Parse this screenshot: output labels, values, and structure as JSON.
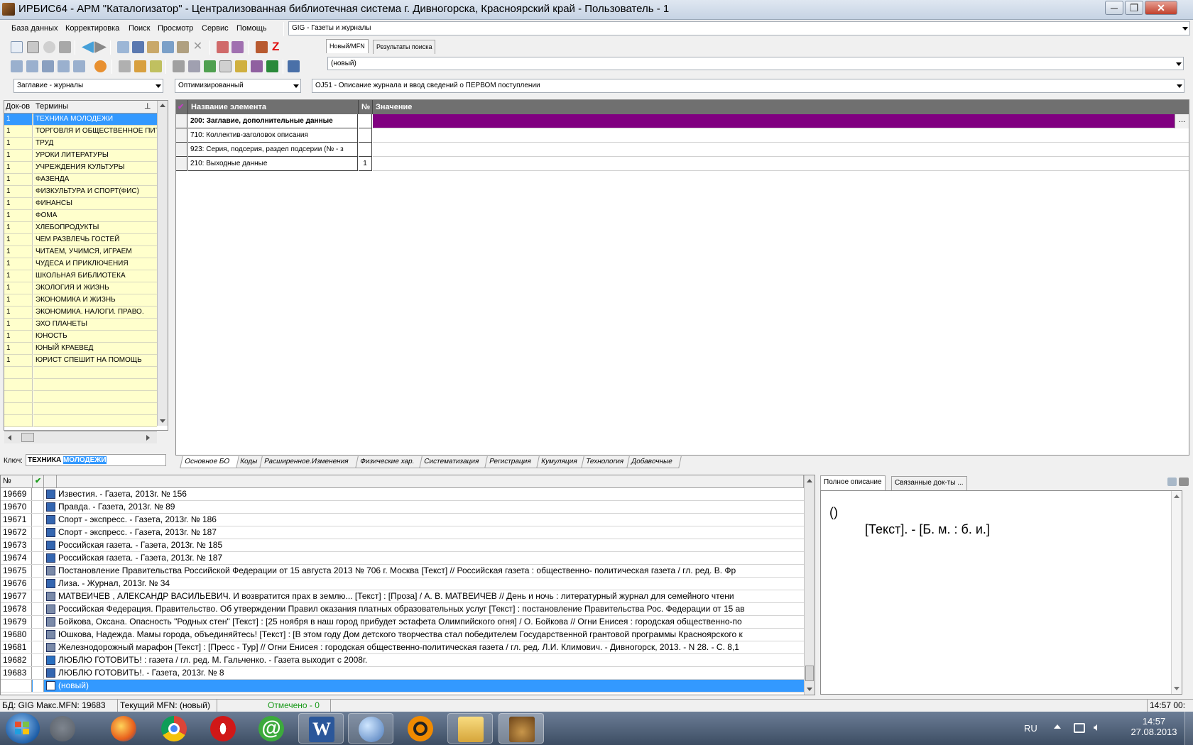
{
  "window": {
    "title": "ИРБИС64 - АРМ \"Каталогизатор\" - Централизованная библиотечная система г. Дивногорска, Красноярский край - Пользователь - 1",
    "minimize": "─",
    "maximize": "❐",
    "close": "✕"
  },
  "menu": {
    "items": [
      "База данных",
      "Корректировка",
      "Поиск",
      "Просмотр",
      "Сервис",
      "Помощь"
    ]
  },
  "database_combo": {
    "value": "GIG - Газеты и журналы"
  },
  "record_tabs": {
    "new_mfn": "Новый/MFN",
    "search_results": "Результаты поиска"
  },
  "record_combo": {
    "value": "(новый)"
  },
  "dictionary_combo": {
    "value": "Заглавие - журналы"
  },
  "mode_combo": {
    "value": "Оптимизированный"
  },
  "worksheet_combo": {
    "value": "OJ51 - Описание журнала и ввод сведений о ПЕРВОМ поступлении"
  },
  "term_list": {
    "col_docs": "Док-ов",
    "col_terms": "Термины",
    "rows": [
      {
        "count": "1",
        "term": "ТЕХНИКА МОЛОДЕЖИ"
      },
      {
        "count": "1",
        "term": "ТОРГОВЛЯ И ОБЩЕСТВЕННОЕ ПИТАНИЕ"
      },
      {
        "count": "1",
        "term": "ТРУД"
      },
      {
        "count": "1",
        "term": "УРОКИ ЛИТЕРАТУРЫ"
      },
      {
        "count": "1",
        "term": "УЧРЕЖДЕНИЯ КУЛЬТУРЫ"
      },
      {
        "count": "1",
        "term": "ФАЗЕНДА"
      },
      {
        "count": "1",
        "term": "ФИЗКУЛЬТУРА И  СПОРТ(ФИС)"
      },
      {
        "count": "1",
        "term": "ФИНАНСЫ"
      },
      {
        "count": "1",
        "term": "ФОМА"
      },
      {
        "count": "1",
        "term": "ХЛЕБОПРОДУКТЫ"
      },
      {
        "count": "1",
        "term": "ЧЕМ РАЗВЛЕЧЬ ГОСТЕЙ"
      },
      {
        "count": "1",
        "term": "ЧИТАЕМ, УЧИМСЯ, ИГРАЕМ"
      },
      {
        "count": "1",
        "term": "ЧУДЕСА И ПРИКЛЮЧЕНИЯ"
      },
      {
        "count": "1",
        "term": "ШКОЛЬНАЯ БИБЛИОТЕКА"
      },
      {
        "count": "1",
        "term": "ЭКОЛОГИЯ И ЖИЗНЬ"
      },
      {
        "count": "1",
        "term": "ЭКОНОМИКА И  ЖИЗНЬ"
      },
      {
        "count": "1",
        "term": "ЭКОНОМИКА. НАЛОГИ. ПРАВО."
      },
      {
        "count": "1",
        "term": "ЭХО ПЛАНЕТЫ"
      },
      {
        "count": "1",
        "term": "ЮНОСТЬ"
      },
      {
        "count": "1",
        "term": "ЮНЫЙ КРАЕВЕД"
      },
      {
        "count": "1",
        "term": "ЮРИСТ СПЕШИТ НА ПОМОЩЬ"
      }
    ]
  },
  "key_field": {
    "label": "Ключ:",
    "value_plain": "ТЕХНИКА",
    "value_selected": "МОЛОДЕЖИ"
  },
  "field_grid": {
    "col_name": "Название элемента",
    "col_num": "№",
    "col_value": "Значение",
    "rows": [
      {
        "name": "200: Заглавие, дополнительные данные",
        "num": ""
      },
      {
        "name": "710: Коллектив-заголовок описания",
        "num": ""
      },
      {
        "name": "923: Серия, подсерия, раздел подсерии (№ - з",
        "num": ""
      },
      {
        "name": "210: Выходные данные",
        "num": "1"
      }
    ],
    "ellipsis": "..."
  },
  "bottom_tabs": [
    "Основное БО",
    "Коды",
    "Расширенное.Изменения",
    "Физические хар.",
    "Систематизация",
    "Регистрация",
    "Кумуляция",
    "Технология",
    "Добавочные"
  ],
  "records": {
    "col_mfn": "№",
    "col_check": "✔",
    "rows": [
      {
        "mfn": "19669",
        "icon": "issue-icon",
        "text": "Известия. - Газета, 2013г. № 156"
      },
      {
        "mfn": "19670",
        "icon": "issue-icon",
        "text": "Правда. - Газета, 2013г. № 89"
      },
      {
        "mfn": "19671",
        "icon": "issue-icon",
        "text": "Спорт - экспресс. - Газета,  2013г. № 186"
      },
      {
        "mfn": "19672",
        "icon": "issue-icon",
        "text": "Спорт - экспресс. - Газета,  2013г. № 187"
      },
      {
        "mfn": "19673",
        "icon": "issue-icon",
        "text": "Российская  газета. - Газета, 2013г. № 185"
      },
      {
        "mfn": "19674",
        "icon": "issue-icon",
        "text": "Российская  газета. - Газета, 2013г. № 187"
      },
      {
        "mfn": "19675",
        "icon": "article-icon",
        "text": "Постановление  Правительства Российской Федерации от 15 августа 2013 № 706 г. Москва [Текст] // Российская  газета : общественно- политическая газета / гл. ред. В. Фр"
      },
      {
        "mfn": "19676",
        "icon": "issue-icon",
        "text": "Лиза. - Журнал, 2013г. № 34"
      },
      {
        "mfn": "19677",
        "icon": "article-icon",
        "text": "МАТВЕИЧЕВ , АЛЕКСАНДР ВАСИЛЬЕВИЧ. И возвратится прах в землю... [Текст] : [Проза] / А. В. МАТВЕИЧЕВ  // День и ночь : литературный журнал для семейного чтени"
      },
      {
        "mfn": "19678",
        "icon": "article-icon",
        "text": "Российская Федерация. Правительство. Об утверждении Правил оказания платных образовательных услуг  [Текст] : постановление Правительства Рос. Федерации от 15 ав"
      },
      {
        "mfn": "19679",
        "icon": "article-icon",
        "text": "Бойкова, Оксана. Опасность \"Родных стен\" [Текст] : [25 ноября в наш город прибудет эстафета Олимпийского огня] / О. Бойкова // Огни Енисея : городская общественно-по"
      },
      {
        "mfn": "19680",
        "icon": "article-icon",
        "text": "Юшкова, Надежда. Мамы города, объединяйтесь! [Текст] : [В этом году Дом детского творчества стал победителем Государственной грантовой программы Красноярского к"
      },
      {
        "mfn": "19681",
        "icon": "article-icon",
        "text": "Железнодорожный марафон [Текст] : [Пресс - Тур] // Огни Енисея : городская общественно-политическая газета / гл. ред. Л.И. Климович. - Дивногорск, 2013. - N 28. -  С. 8,1"
      },
      {
        "mfn": "19682",
        "icon": "journal-icon",
        "text": "ЛЮБЛЮ ГОТОВИТЬ! : газета / гл. ред. М. Гальченко. - Газета выходит с 2008г."
      },
      {
        "mfn": "19683",
        "icon": "issue-icon",
        "text": "ЛЮБЛЮ ГОТОВИТЬ!. - Газета, 2013г. № 8"
      },
      {
        "mfn": "",
        "icon": "new-doc-icon",
        "text": "(новый)"
      }
    ]
  },
  "desc_tabs": {
    "full": "Полное описание",
    "linked": "Связанные док-ты ..."
  },
  "description": {
    "line1": "()",
    "line2": "[Текст]. - [Б. м. : б. и.]"
  },
  "status": {
    "db": "БД: GIG Макс.MFN: 19683",
    "current": "Текущий MFN: (новый)",
    "marked": "Отмечено - 0",
    "time": "14:57  00:"
  },
  "taskbar": {
    "lang": "RU",
    "clock_time": "14:57",
    "clock_date": "27.08.2013",
    "tasks": [
      "windows-start",
      "library-app",
      "firefox",
      "chrome",
      "opera",
      "mail-agent",
      "word",
      "search-tool",
      "avast",
      "file-explorer",
      "irbis"
    ]
  },
  "colors": {
    "selection": "#3399ff",
    "value_highlight": "#800080",
    "term_bg": "#ffffcc",
    "grid_header": "#707070"
  }
}
